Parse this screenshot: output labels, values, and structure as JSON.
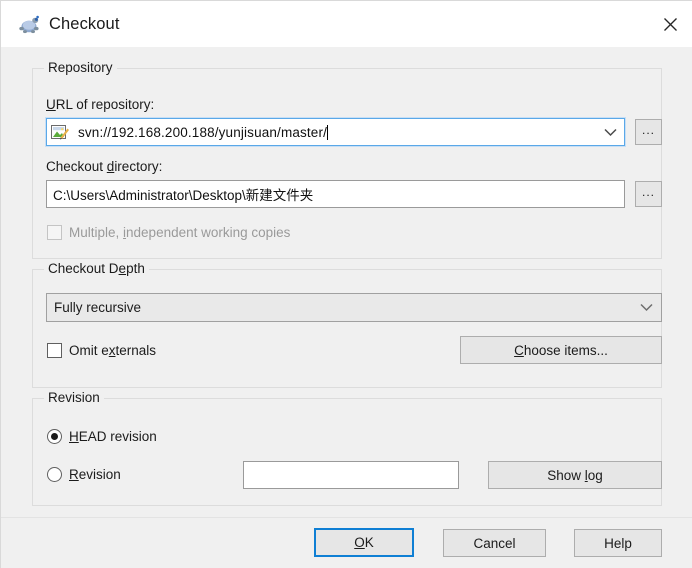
{
  "window": {
    "title": "Checkout",
    "app_icon": "tortoise-svn-icon",
    "close_icon": "close-icon"
  },
  "repository": {
    "group_label": "Repository",
    "url_label_before": "U",
    "url_label_after": "RL of repository:",
    "url_value": "svn://192.168.200.188/yunjisuan/master/",
    "url_field_icon": "repository-edit-icon",
    "url_dropdown_icon": "chevron-down-icon",
    "url_browse_label": "...",
    "dir_label_before": "Checkout ",
    "dir_label_accel": "d",
    "dir_label_after": "irectory:",
    "dir_value": "C:\\Users\\Administrator\\Desktop\\新建文件夹",
    "dir_browse_label": "...",
    "multiple_checkbox_label_before": "Multiple, ",
    "multiple_checkbox_accel": "i",
    "multiple_checkbox_label_after": "ndependent working copies",
    "multiple_checkbox_checked": false,
    "multiple_checkbox_disabled": true
  },
  "depth": {
    "group_label_before": "Checkout D",
    "group_label_accel": "e",
    "group_label_after": "pth",
    "selected_option": "Fully recursive",
    "dropdown_icon": "chevron-down-icon",
    "omit_externals_label_before": "Omit e",
    "omit_externals_accel": "x",
    "omit_externals_label_after": "ternals",
    "omit_externals_checked": false,
    "choose_items_before": "",
    "choose_items_accel": "C",
    "choose_items_after": "hoose items..."
  },
  "revision": {
    "group_label": "Revision",
    "head_accel": "H",
    "head_label_after": "EAD revision",
    "head_selected": true,
    "revision_accel": "R",
    "revision_label_after": "evision",
    "revision_selected": false,
    "revision_value": "",
    "show_log_before": "Show ",
    "show_log_accel": "l",
    "show_log_after": "og"
  },
  "footer": {
    "ok_accel": "O",
    "ok_after": "K",
    "cancel_label": "Cancel",
    "help_label": "Help"
  },
  "colors": {
    "window_bg": "#f0f0f0",
    "titlebar_bg": "#ffffff",
    "focus_blue": "#0f7fd4",
    "field_border": "#9a9a9a",
    "group_border": "#dcdcdc",
    "disabled_text": "#9a9a9a"
  }
}
